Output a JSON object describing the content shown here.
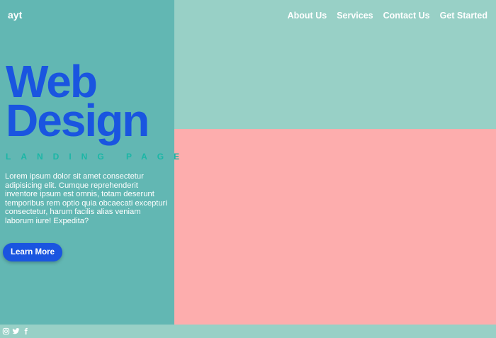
{
  "brand": {
    "logo_text": "ayt"
  },
  "nav": {
    "items": [
      {
        "label": "About Us"
      },
      {
        "label": "Services"
      },
      {
        "label": "Contact Us"
      },
      {
        "label": "Get Started"
      }
    ]
  },
  "hero": {
    "title_line1": "Web",
    "title_line2": "Design",
    "subtitle": "LANDING PAGE",
    "body": "Lorem ipsum dolor sit amet consectetur adipisicing elit. Cumque reprehenderit inventore ipsum est omnis, totam deserunt temporibus rem optio quia obcaecati excepturi consectetur, harum facilis alias veniam laborum iure! Expedita?",
    "cta_label": "Learn More"
  },
  "footer": {
    "social_icons": [
      "instagram-icon",
      "twitter-icon",
      "facebook-icon"
    ]
  },
  "colors": {
    "left_panel": "#62b7b3",
    "right_top": "#98d0c6",
    "right_bottom": "#fdadad",
    "accent_blue": "#1a55e0",
    "accent_teal": "#1bb6a6"
  }
}
